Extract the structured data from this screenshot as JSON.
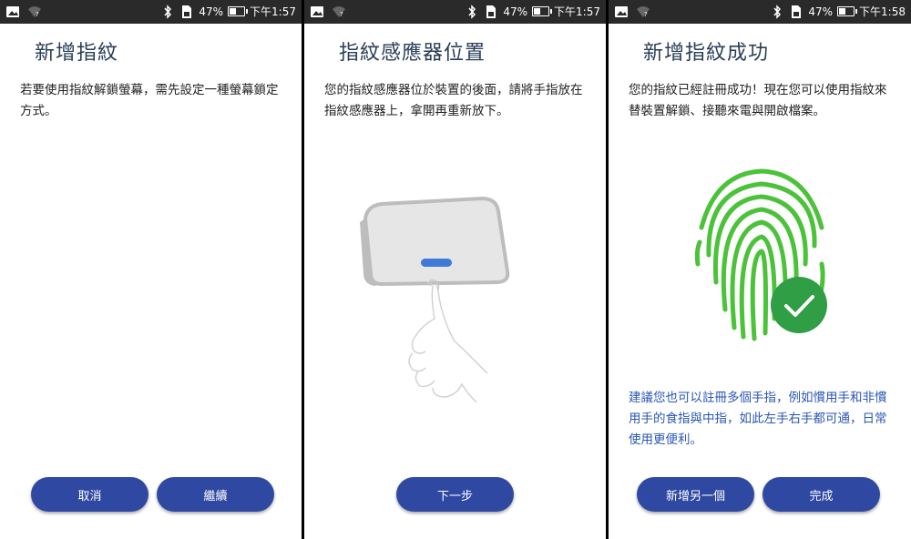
{
  "status": {
    "battery": "47%",
    "battery_level": 0.47,
    "time_1": "下午1:57",
    "time_2": "下午1:57",
    "time_3": "下午1:58"
  },
  "screen1": {
    "title": "新增指紋",
    "description": "若要使用指紋解鎖螢幕，需先設定一種螢幕鎖定方式。",
    "cancel_label": "取消",
    "continue_label": "繼續"
  },
  "screen2": {
    "title": "指紋感應器位置",
    "description": "您的指紋感應器位於裝置的後面，請將手指放在指紋感應器上，拿開再重新放下。",
    "next_label": "下一步"
  },
  "screen3": {
    "title": "新增指紋成功",
    "description": "您的指紋已經註冊成功！現在您可以使用指紋來替裝置解鎖、接聽來電與開啟檔案。",
    "hint": "建議您也可以註冊多個手指，例如慣用手和非慣用手的食指與中指，如此左手右手都可通，日常使用更便利。",
    "add_another_label": "新增另一個",
    "done_label": "完成"
  },
  "colors": {
    "button": "#2f49a3",
    "fingerprint": "#4bc23a",
    "check": "#2f9e44",
    "hint_text": "#2a56b5"
  },
  "icons": [
    "image-icon",
    "wifi-icon",
    "bluetooth-icon",
    "sim-card-icon",
    "battery-icon",
    "fingerprint-icon",
    "check-icon"
  ]
}
